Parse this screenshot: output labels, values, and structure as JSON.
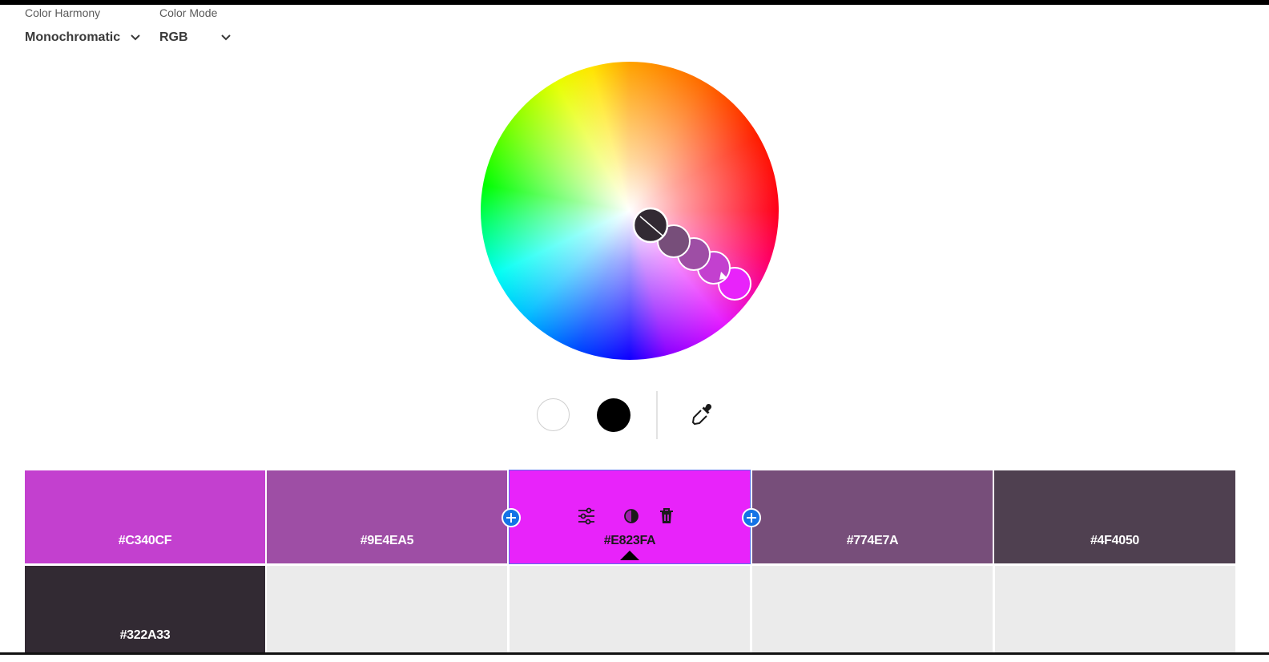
{
  "controls": {
    "harmony_label": "Color Harmony",
    "harmony_value": "Monochromatic",
    "mode_label": "Color Mode",
    "mode_value": "RGB"
  },
  "wheel": {
    "handle_colors": [
      "#322A33",
      "#774E7A",
      "#9E4EA5",
      "#C340CF",
      "#E823FA"
    ]
  },
  "tools": {
    "white": "#FFFFFF",
    "black": "#000000",
    "eyedropper_icon": "eyedropper-icon"
  },
  "palette": {
    "swatches": [
      {
        "hex": "#C340CF",
        "color": "#C340CF"
      },
      {
        "hex": "#9E4EA5",
        "color": "#9E4EA5"
      },
      {
        "hex": "#E823FA",
        "color": "#E823FA",
        "selected": true
      },
      {
        "hex": "#774E7A",
        "color": "#774E7A"
      },
      {
        "hex": "#4F4050",
        "color": "#4F4050"
      },
      {
        "hex": "#322A33",
        "color": "#322A33"
      }
    ],
    "selected_actions": [
      "sliders-icon",
      "contrast-icon",
      "trash-icon"
    ]
  }
}
